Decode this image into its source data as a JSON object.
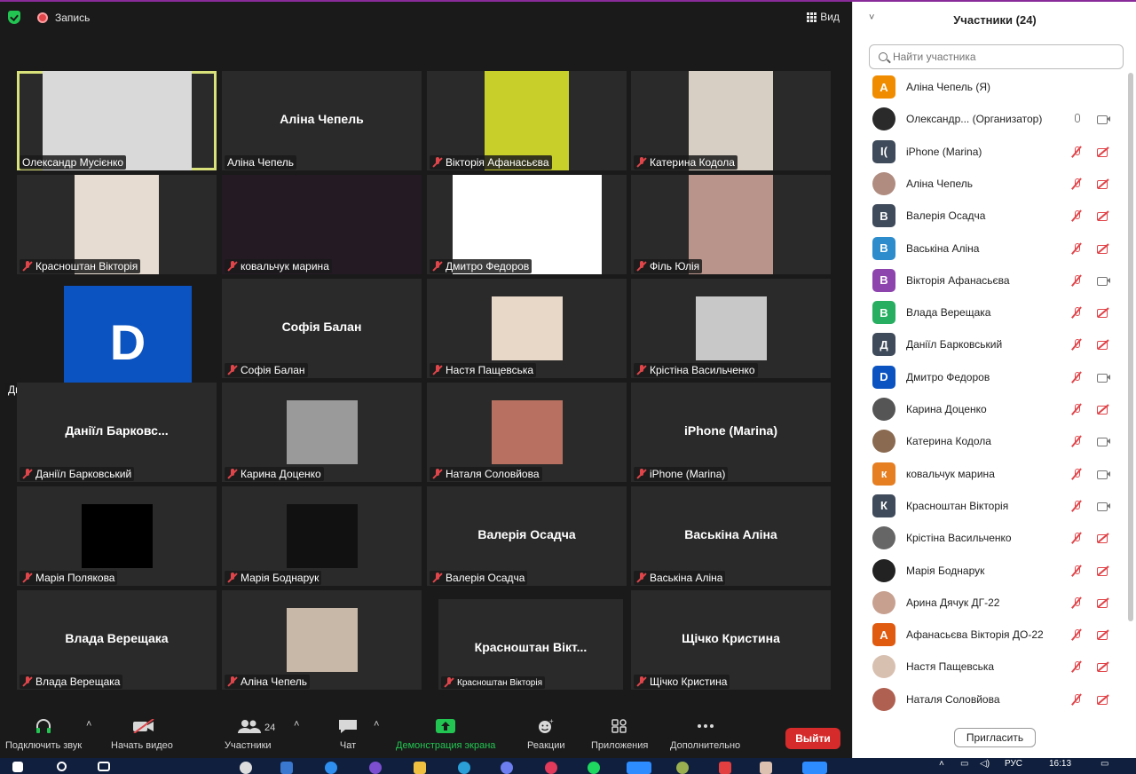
{
  "topbar": {
    "recording_label": "Запись",
    "view_label": "Вид"
  },
  "tiles": [
    {
      "label": "Олександр Мусієнко",
      "big": "",
      "muted": false,
      "photo": "#d9d9d9"
    },
    {
      "label": "Аліна Чепель",
      "big": "Аліна Чепель",
      "muted": false,
      "photo": ""
    },
    {
      "label": "Вікторія Афанасьєва",
      "big": "",
      "muted": true,
      "photo": "#c9cf2a"
    },
    {
      "label": "Катерина Кодола",
      "big": "",
      "muted": true,
      "photo": "#d8cfc4"
    },
    {
      "label": "Красноштан Вікторія",
      "big": "",
      "muted": true,
      "photo": "#e6dcd2"
    },
    {
      "label": "ковальчук марина",
      "big": "",
      "muted": true,
      "photo": ""
    },
    {
      "label": "Дмитро Федоров",
      "big": "",
      "muted": true,
      "photo": "#ffffff"
    },
    {
      "label": "Філь Юлія",
      "big": "",
      "muted": true,
      "photo": "#b9948a"
    },
    {
      "label": "Дмитро Федоров",
      "big": "D",
      "muted": false,
      "photo": "#0b53c1"
    },
    {
      "label": "Софія Балан",
      "big": "Софія Балан",
      "muted": true,
      "photo": ""
    },
    {
      "label": "Настя Пащевська",
      "big": "",
      "muted": true,
      "photo": "#e8d8c8"
    },
    {
      "label": "Крістіна Васильченко",
      "big": "",
      "muted": true,
      "photo": "#c8c8c8"
    },
    {
      "label": "Даніїл Барковський",
      "big": "Даніїл Барковс...",
      "muted": true,
      "photo": ""
    },
    {
      "label": "Карина Доценко",
      "big": "",
      "muted": true,
      "photo": "#9a9a9a"
    },
    {
      "label": "Наталя Соловйова",
      "big": "",
      "muted": true,
      "photo": "#b87060"
    },
    {
      "label": "iPhone (Marina)",
      "big": "iPhone (Marina)",
      "muted": true,
      "photo": ""
    },
    {
      "label": "Марія Полякова",
      "big": "",
      "muted": true,
      "photo": "#000000"
    },
    {
      "label": "Марія Боднарук",
      "big": "",
      "muted": true,
      "photo": "#111111"
    },
    {
      "label": "Валерія Осадча",
      "big": "Валерія Осадча",
      "muted": true,
      "photo": ""
    },
    {
      "label": "Васькіна Аліна",
      "big": "Васькіна Аліна",
      "muted": true,
      "photo": ""
    },
    {
      "label": "Влада Верещака",
      "big": "Влада Верещака",
      "muted": true,
      "photo": ""
    },
    {
      "label": "Аліна Чепель",
      "big": "",
      "muted": true,
      "photo": "#c8b8a8"
    },
    {
      "label": "Красноштан Вікторія",
      "big": "Красноштан Вікт...",
      "muted": true,
      "photo": ""
    },
    {
      "label": "Щічко Кристина",
      "big": "Щічко Кристина",
      "muted": true,
      "photo": ""
    }
  ],
  "toolbar": {
    "audio": "Подключить звук",
    "video": "Начать видео",
    "participants": "Участники",
    "participants_count": "24",
    "chat": "Чат",
    "share": "Демонстрация экрана",
    "reactions": "Реакции",
    "apps": "Приложения",
    "more": "Дополнительно",
    "leave": "Выйти"
  },
  "panel": {
    "title": "Участники (24)",
    "search_placeholder": "Найти участника",
    "invite": "Пригласить",
    "participants": [
      {
        "name": "Аліна Чепель (Я)",
        "initial": "А",
        "color": "#f08c00",
        "mic": "none",
        "cam": "none"
      },
      {
        "name": "Олександр...  (Организатор)",
        "initial": "",
        "color": "#2a2a2a",
        "mic": "on",
        "cam": "on"
      },
      {
        "name": "iPhone (Marina)",
        "initial": "I(",
        "color": "#3f4a5a",
        "mic": "off",
        "cam": "off"
      },
      {
        "name": "Аліна Чепель",
        "initial": "",
        "color": "#b08c80",
        "mic": "off",
        "cam": "off"
      },
      {
        "name": "Валерія Осадча",
        "initial": "В",
        "color": "#3f4a5a",
        "mic": "off",
        "cam": "off"
      },
      {
        "name": "Васькіна Аліна",
        "initial": "В",
        "color": "#2d8ccc",
        "mic": "off",
        "cam": "off"
      },
      {
        "name": "Вікторія Афанасьєва",
        "initial": "В",
        "color": "#8e44ad",
        "mic": "off",
        "cam": "on"
      },
      {
        "name": "Влада Верещака",
        "initial": "В",
        "color": "#27ae60",
        "mic": "off",
        "cam": "off"
      },
      {
        "name": "Даніїл Барковський",
        "initial": "Д",
        "color": "#3f4a5a",
        "mic": "off",
        "cam": "off"
      },
      {
        "name": "Дмитро Федоров",
        "initial": "D",
        "color": "#0b53c1",
        "mic": "off",
        "cam": "on"
      },
      {
        "name": "Карина Доценко",
        "initial": "",
        "color": "#555555",
        "mic": "off",
        "cam": "off"
      },
      {
        "name": "Катерина Кодола",
        "initial": "",
        "color": "#8a6a50",
        "mic": "off",
        "cam": "on"
      },
      {
        "name": "ковальчук марина",
        "initial": "к",
        "color": "#e67e22",
        "mic": "off",
        "cam": "on"
      },
      {
        "name": "Красноштан Вікторія",
        "initial": "К",
        "color": "#3f4a5a",
        "mic": "off",
        "cam": "on"
      },
      {
        "name": "Крістіна Васильченко",
        "initial": "",
        "color": "#666666",
        "mic": "off",
        "cam": "off"
      },
      {
        "name": "Марія Боднарук",
        "initial": "",
        "color": "#222222",
        "mic": "off",
        "cam": "off"
      },
      {
        "name": "Арина Дячук ДГ-22",
        "initial": "",
        "color": "#c7a090",
        "mic": "off",
        "cam": "off"
      },
      {
        "name": "Афанасьєва Вікторія ДО-22",
        "initial": "А",
        "color": "#e05a10",
        "mic": "off",
        "cam": "off"
      },
      {
        "name": "Настя Пащевська",
        "initial": "",
        "color": "#d8c0b0",
        "mic": "off",
        "cam": "off"
      },
      {
        "name": "Наталя Соловйова",
        "initial": "",
        "color": "#b06050",
        "mic": "off",
        "cam": "off"
      }
    ]
  },
  "taskbar": {
    "lang": "РУС",
    "time": "16:13"
  }
}
